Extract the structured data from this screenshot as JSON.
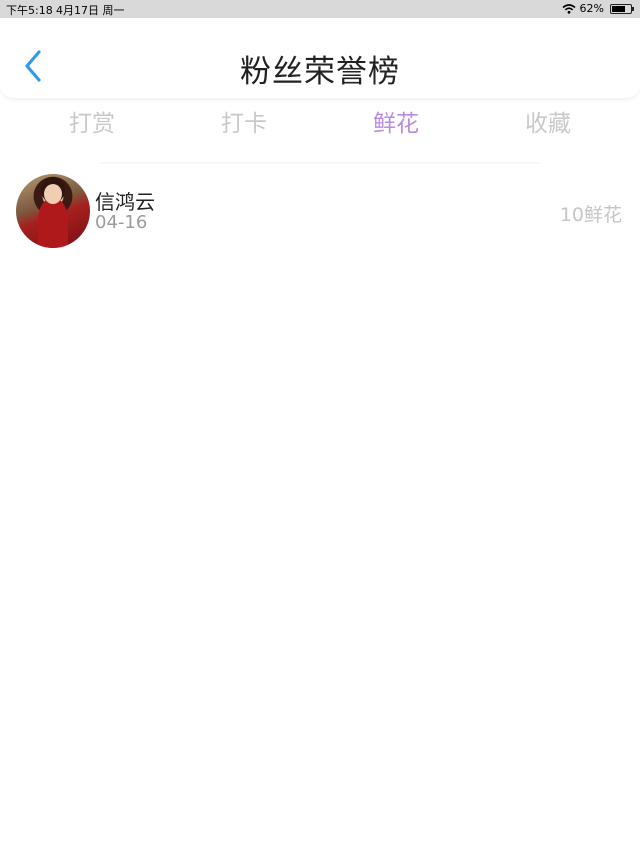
{
  "status_bar": {
    "time": "下午5:18",
    "date": "4月17日 周一",
    "battery": "62%"
  },
  "header": {
    "title": "粉丝荣誉榜"
  },
  "tabs": [
    {
      "label": "打赏",
      "active": false
    },
    {
      "label": "打卡",
      "active": false
    },
    {
      "label": "鲜花",
      "active": true
    },
    {
      "label": "收藏",
      "active": false
    }
  ],
  "list": [
    {
      "name": "信鸿云",
      "date": "04-16",
      "value": "10鲜花"
    }
  ],
  "colors": {
    "accent": "#b98be0",
    "back": "#2f9be6",
    "inactive": "#c9c9c9"
  }
}
